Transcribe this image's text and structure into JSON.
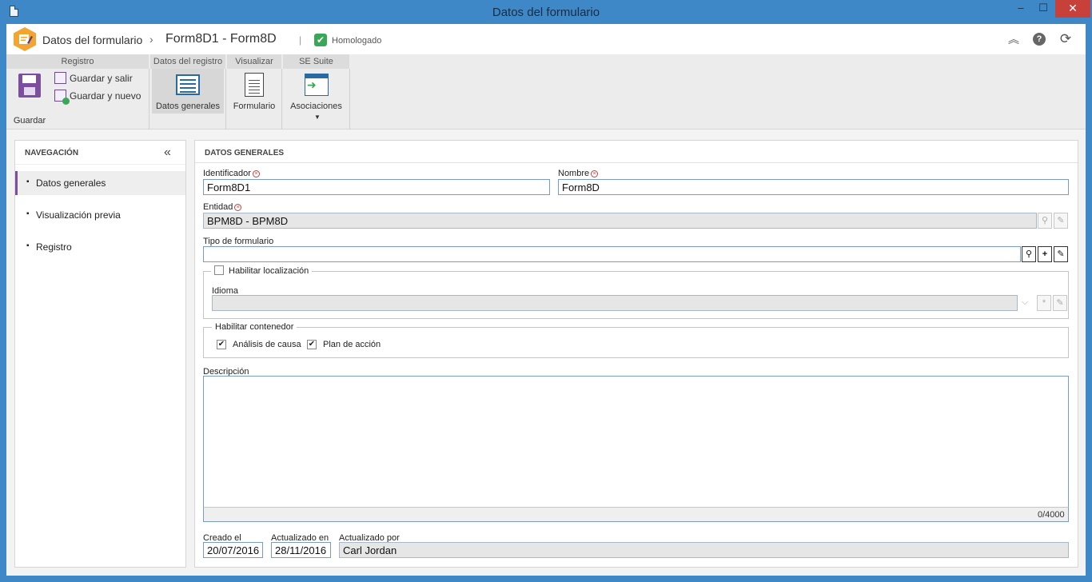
{
  "window": {
    "title": "Datos del formulario",
    "minimize": "–",
    "maximize": "☐",
    "close": "✕"
  },
  "header": {
    "crumb_root": "Datos del formulario",
    "crumb_sep": "›",
    "record_title": "Form8D1 - Form8D",
    "separator": "|",
    "status": "Homologado",
    "status_check": "✔",
    "icons": {
      "collapse": "︽",
      "help": "?",
      "refresh": "⟳"
    }
  },
  "ribbon": {
    "groups": {
      "registro": "Registro",
      "datos_registro": "Datos del registro",
      "visualizar": "Visualizar",
      "se_suite": "SE Suite"
    },
    "buttons": {
      "guardar": "Guardar",
      "guardar_salir": "Guardar y salir",
      "guardar_nuevo": "Guardar y nuevo",
      "datos_generales": "Datos generales",
      "formulario": "Formulario",
      "asociaciones": "Asociaciones",
      "asociaciones_caret": "▼"
    }
  },
  "nav": {
    "title": "NAVEGACIÓN",
    "collapse": "«",
    "bullet": "▪",
    "items": [
      {
        "label": "Datos generales"
      },
      {
        "label": "Visualización previa"
      },
      {
        "label": "Registro"
      }
    ]
  },
  "main": {
    "title": "DATOS GENERALES",
    "required_mark": "×",
    "fields": {
      "identificador": {
        "label": "Identificador",
        "value": "Form8D1"
      },
      "nombre": {
        "label": "Nombre",
        "value": "Form8D"
      },
      "entidad": {
        "label": "Entidad",
        "value": "BPM8D - BPM8D"
      },
      "tipo": {
        "label": "Tipo de formulario",
        "value": ""
      },
      "idioma": {
        "label": "Idioma",
        "value": ""
      },
      "descripcion": {
        "label": "Descripción",
        "counter": "0/4000"
      },
      "creado": {
        "label": "Creado el",
        "value": "20/07/2016"
      },
      "actualizado_en": {
        "label": "Actualizado en",
        "value": "28/11/2016"
      },
      "actualizado_por": {
        "label": "Actualizado por",
        "value": "Carl Jordan"
      }
    },
    "localizacion": {
      "label": "Habilitar localización",
      "checked": false
    },
    "contenedor": {
      "legend": "Habilitar contenedor",
      "analisis": {
        "label": "Análisis de causa",
        "checked": true
      },
      "plan": {
        "label": "Plan de acción",
        "checked": true
      }
    },
    "icons": {
      "search": "⚲",
      "add": "+",
      "clear": "✎",
      "dropdown": "⌵",
      "asterisk": "*",
      "check": "✔"
    }
  }
}
